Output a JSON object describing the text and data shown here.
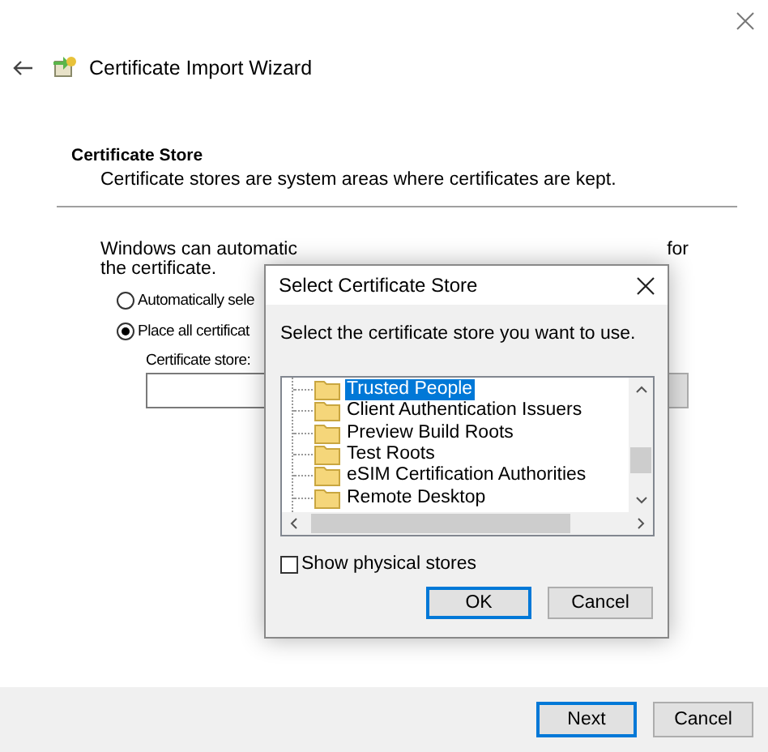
{
  "wizard": {
    "title": "Certificate Import Wizard",
    "heading": "Certificate Store",
    "subheading": "Certificate stores are system areas where certificates are kept.",
    "intro_start": "Windows can automatic",
    "intro_end": "for",
    "intro_line_2": "the certificate.",
    "options": [
      {
        "label": "Automatically sele",
        "selected": false
      },
      {
        "label": "Place all certificat",
        "selected": true
      }
    ],
    "store_label": "Certificate store:",
    "buttons": [
      {
        "label": "Next",
        "default": true
      },
      {
        "label": "Cancel",
        "default": false
      }
    ]
  },
  "dialog": {
    "title": "Select Certificate Store",
    "prompt": "Select the certificate store you want to use.",
    "stores": [
      {
        "label": "Trusted People",
        "selected": true
      },
      {
        "label": "Client Authentication Issuers",
        "selected": false
      },
      {
        "label": "Preview Build Roots",
        "selected": false
      },
      {
        "label": "Test Roots",
        "selected": false
      },
      {
        "label": "eSIM Certification Authorities",
        "selected": false
      },
      {
        "label": "Remote Desktop",
        "selected": false
      }
    ],
    "show_physical": {
      "label": "Show physical stores",
      "checked": false
    },
    "buttons": [
      {
        "label": "OK",
        "default": true
      },
      {
        "label": "Cancel",
        "default": false
      }
    ]
  }
}
